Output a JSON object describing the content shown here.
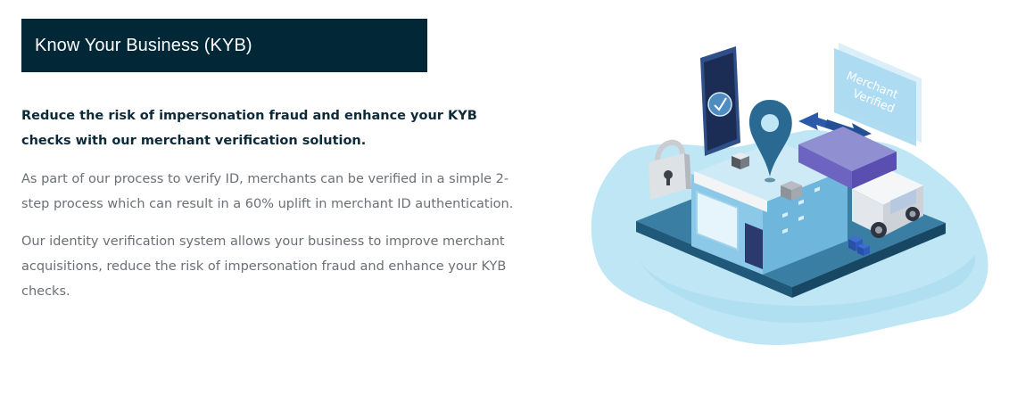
{
  "header": {
    "title": "Know Your Business (KYB)"
  },
  "content": {
    "lead": "Reduce the risk of impersonation fraud and enhance your KYB checks with our merchant verification solution.",
    "paragraphs": [
      "As part of our process to verify ID, merchants can be verified in a simple 2-step process which can result in a 60% uplift in merchant ID authentication.",
      "Our identity verification system allows your business to improve merchant acquisitions, reduce the risk of impersonation fraud and enhance your KYB checks."
    ]
  },
  "illustration": {
    "sign_line1": "Merchant",
    "sign_line2": "Verified",
    "icons": [
      "smartphone-icon",
      "checkmark-icon",
      "map-pin-icon",
      "padlock-icon",
      "delivery-truck-icon",
      "storefront-icon",
      "swap-arrows-icon"
    ]
  },
  "colors": {
    "banner": "#022838",
    "lead_text": "#0d2a3a",
    "body_text": "#6b6f76",
    "blob": "#bfe6f5",
    "platform": "#2d6f91"
  }
}
